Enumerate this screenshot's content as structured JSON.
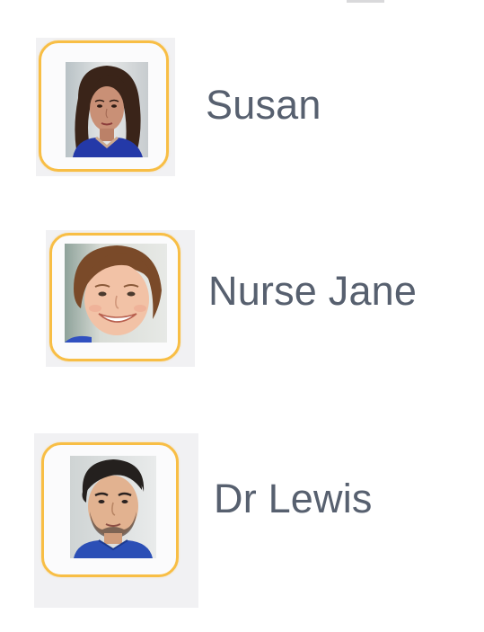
{
  "contacts": [
    {
      "name": "Susan",
      "avatar_icon": "woman-dark-hair-avatar"
    },
    {
      "name": "Nurse Jane",
      "avatar_icon": "woman-smiling-avatar"
    },
    {
      "name": "Dr Lewis",
      "avatar_icon": "man-beard-avatar"
    }
  ],
  "colors": {
    "frame_border": "#f8be45",
    "name_text": "#57606f",
    "tile_background": "#f1f1f3",
    "page_background": "#ffffff"
  }
}
